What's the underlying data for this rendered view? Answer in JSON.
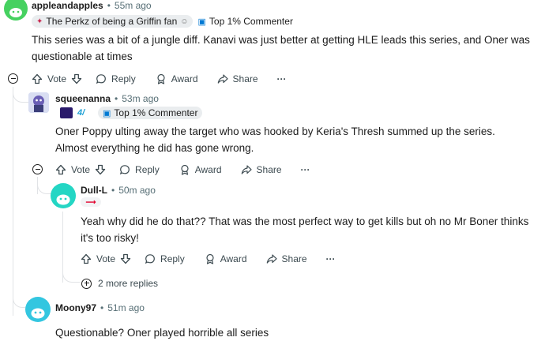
{
  "comments": [
    {
      "username": "appleandapples",
      "time": "55m ago",
      "flairs": [
        "The Perkz of being a Griffin fan",
        "Top 1% Commenter"
      ],
      "body": "This series was a bit of a jungle diff. Kanavi was just better at getting HLE leads this series, and Oner was questionable at times",
      "avatar_color": "#46d160"
    },
    {
      "username": "squeenanna",
      "time": "53m ago",
      "flairs": [
        "Top 1% Commenter"
      ],
      "body": "Oner Poppy ulting away the target who was hooked by Keria's Thresh summed up the series. Almost everything he did has gone wrong.",
      "avatar_color": "#7b8fcc"
    },
    {
      "username": "Dull-L",
      "time": "50m ago",
      "flairs": [],
      "body": "Yeah why did he do that?? That was the most perfect way to get kills but oh no Mr Boner thinks it's too risky!",
      "avatar_color": "#24d6c4"
    },
    {
      "username": "Moony97",
      "time": "51m ago",
      "flairs": [],
      "body": "Questionable? Oner played horrible all series",
      "avatar_color": "#33c6e0"
    }
  ],
  "actions": {
    "vote": "Vote",
    "reply": "Reply",
    "award": "Award",
    "share": "Share",
    "more": "···"
  },
  "more_replies": "2 more replies",
  "separator": "•"
}
